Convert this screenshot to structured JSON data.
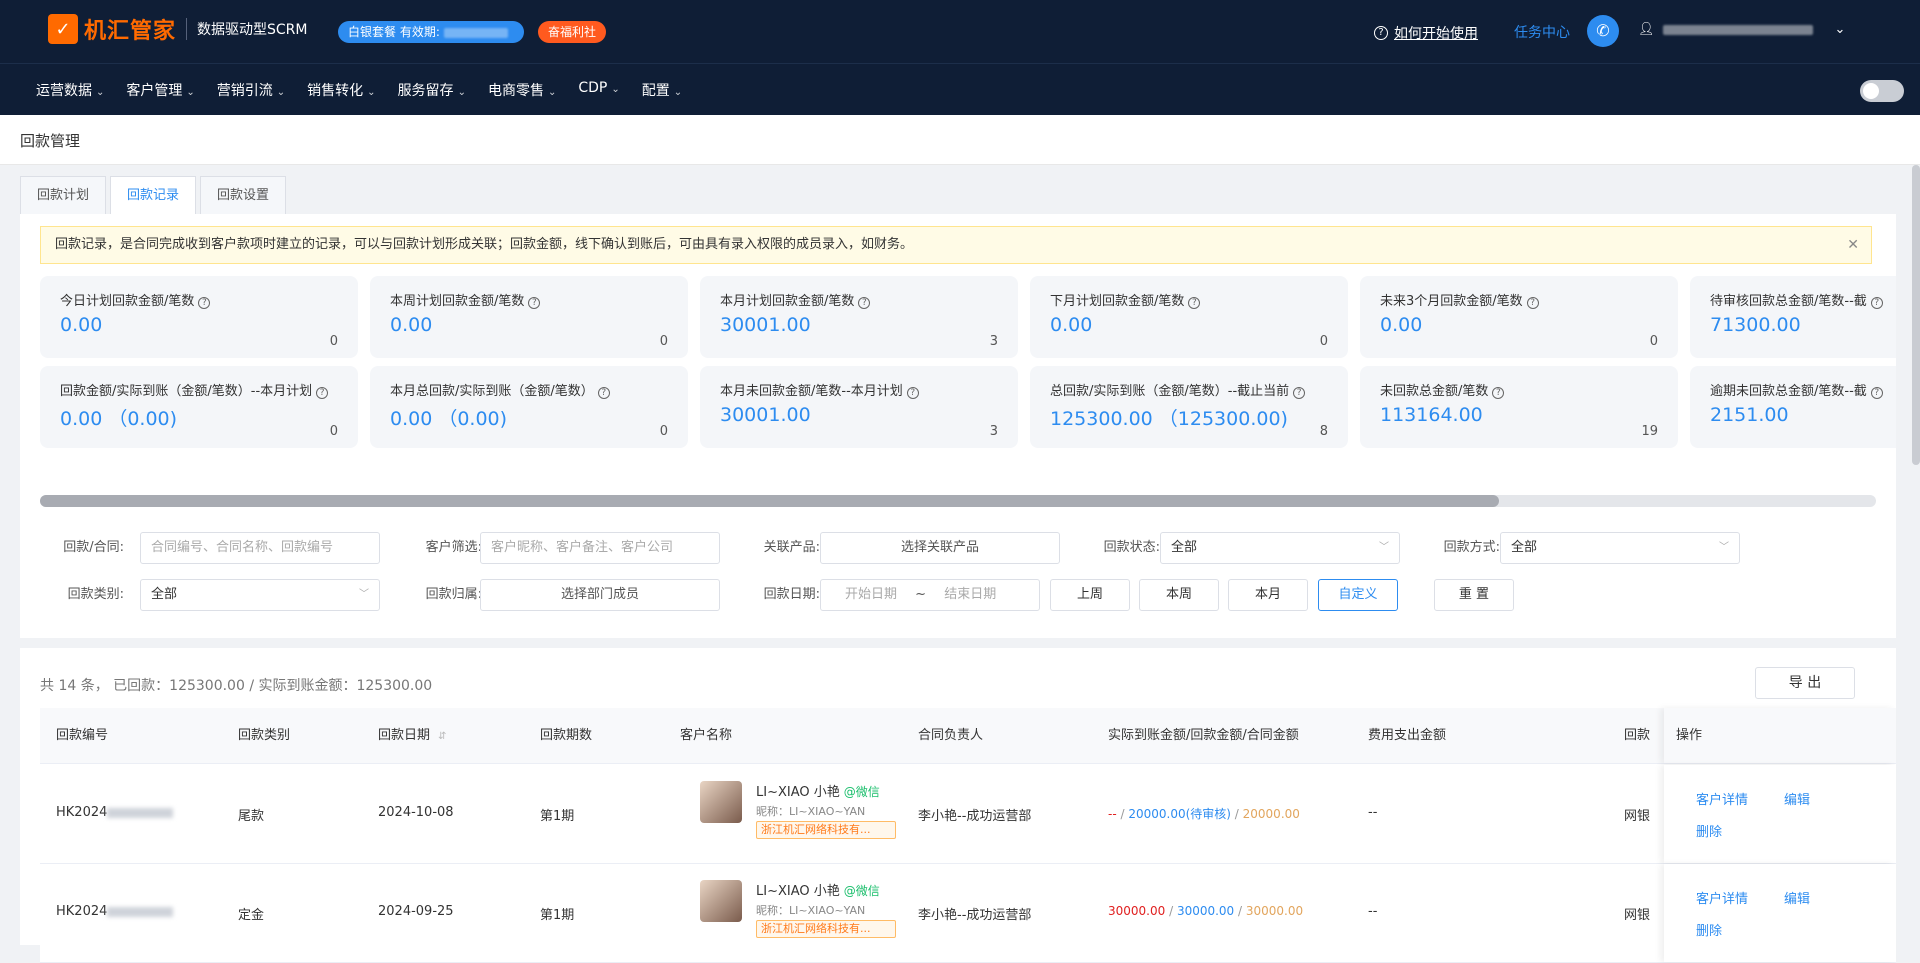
{
  "header": {
    "logo_mark": "✓",
    "logo_text": "机汇管家",
    "subtitle": "数据驱动型SCRM",
    "package_label": "白银套餐 有效期:",
    "welfare_label": "奋福利社",
    "help_label": "如何开始使用",
    "task_center": "任务中心"
  },
  "nav": {
    "items": [
      "运营数据",
      "客户管理",
      "营销引流",
      "销售转化",
      "服务留存",
      "电商零售",
      "CDP",
      "配置"
    ]
  },
  "page": {
    "title": "回款管理",
    "tabs": [
      "回款计划",
      "回款记录",
      "回款设置"
    ],
    "active_tab": 1
  },
  "notice": {
    "text": "回款记录，是合同完成收到客户款项时建立的记录，可以与回款计划形成关联；回款金额，线下确认到账后，可由具有录入权限的成员录入，如财务。"
  },
  "stats": [
    {
      "label": "今日计划回款金额/笔数",
      "value": "0.00",
      "count": "0"
    },
    {
      "label": "本周计划回款金额/笔数",
      "value": "0.00",
      "count": "0"
    },
    {
      "label": "本月计划回款金额/笔数",
      "value": "30001.00",
      "count": "3"
    },
    {
      "label": "下月计划回款金额/笔数",
      "value": "0.00",
      "count": "0"
    },
    {
      "label": "未来3个月回款金额/笔数",
      "value": "0.00",
      "count": "0"
    },
    {
      "label": "待审核回款总金额/笔数--截",
      "value": "71300.00",
      "count": ""
    },
    {
      "label": "回款金额/实际到账（金额/笔数）--本月计划",
      "value": "0.00 （0.00)",
      "count": "0"
    },
    {
      "label": "本月总回款/实际到账（金额/笔数）",
      "value": "0.00 （0.00)",
      "count": "0"
    },
    {
      "label": "本月未回款金额/笔数--本月计划",
      "value": "30001.00",
      "count": "3"
    },
    {
      "label": "总回款/实际到账（金额/笔数）--截止当前",
      "value": "125300.00 （125300.00)",
      "count": "8"
    },
    {
      "label": "未回款总金额/笔数",
      "value": "113164.00",
      "count": "19"
    },
    {
      "label": "逾期未回款总金额/笔数--截",
      "value": "2151.00",
      "count": ""
    }
  ],
  "filters": {
    "payment_contract_label": "回款/合同:",
    "payment_contract_placeholder": "合同编号、合同名称、回款编号",
    "customer_label": "客户筛选:",
    "customer_placeholder": "客户昵称、客户备注、客户公司",
    "product_label": "关联产品:",
    "product_button": "选择关联产品",
    "status_label": "回款状态:",
    "status_value": "全部",
    "method_label": "回款方式:",
    "method_value": "全部",
    "type_label": "回款类别:",
    "type_value": "全部",
    "owner_label": "回款归属:",
    "owner_button": "选择部门成员",
    "date_label": "回款日期:",
    "date_start": "开始日期",
    "date_sep": "~",
    "date_end": "结束日期",
    "quick": [
      "上周",
      "本周",
      "本月",
      "自定义"
    ],
    "reset": "重 置"
  },
  "table": {
    "summary": "共 14 条，  已回款：125300.00 / 实际到账金额：125300.00",
    "export": "导 出",
    "columns": [
      "回款编号",
      "回款类别",
      "回款日期",
      "回款期数",
      "客户名称",
      "合同负责人",
      "实际到账金额/回款金额/合同金额",
      "费用支出金额",
      "回款",
      "操作"
    ],
    "sort_icon": "sort-icon",
    "rows": [
      {
        "id_prefix": "HK2024",
        "type": "尾款",
        "date": "2024-10-08",
        "period": "第1期",
        "customer": "LI~XIAO 小艳",
        "channel": "@微信",
        "nickname": "昵称：LI~XIAO~YAN",
        "company": "浙江机汇网络科技有...",
        "owner": "李小艳--成功运营部",
        "actual": "--",
        "amount": "20000.00(待审核)",
        "contract": "20000.00",
        "expense": "--",
        "method": "网银",
        "ops": [
          "客户详情",
          "编辑",
          "删除"
        ]
      },
      {
        "id_prefix": "HK2024",
        "type": "定金",
        "date": "2024-09-25",
        "period": "第1期",
        "customer": "LI~XIAO 小艳",
        "channel": "@微信",
        "nickname": "昵称：LI~XIAO~YAN",
        "company": "浙江机汇网络科技有...",
        "owner": "李小艳--成功运营部",
        "actual": "30000.00",
        "amount": "30000.00",
        "contract": "30000.00",
        "expense": "--",
        "method": "网银",
        "ops": [
          "客户详情",
          "编辑",
          "删除"
        ]
      }
    ]
  },
  "colors": {
    "nav_bg": "#0f1e36",
    "accent": "#2d8cf0",
    "brand": "#ff6a00",
    "danger": "#e02020",
    "gold": "#e2a55d"
  }
}
